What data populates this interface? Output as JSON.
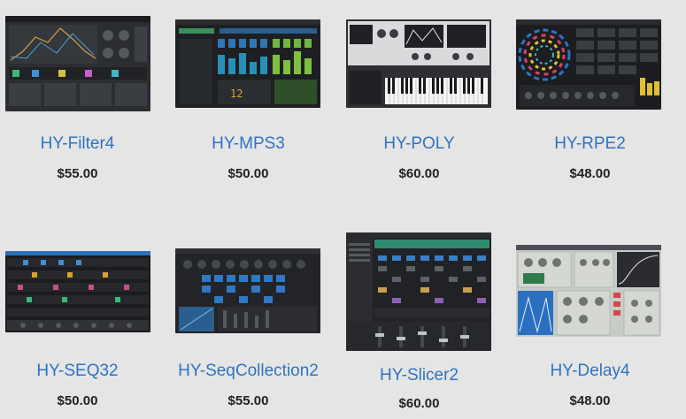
{
  "products": [
    {
      "name": "HY-Filter4",
      "price": "$55.00",
      "image": "filter-plugin-screenshot"
    },
    {
      "name": "HY-MPS3",
      "price": "$50.00",
      "image": "sequencer-plugin-screenshot"
    },
    {
      "name": "HY-POLY",
      "price": "$60.00",
      "image": "synth-with-keyboard-screenshot"
    },
    {
      "name": "HY-RPE2",
      "price": "$48.00",
      "image": "circular-sequencer-screenshot"
    },
    {
      "name": "HY-SEQ32",
      "price": "$50.00",
      "image": "step-sequencer-screenshot"
    },
    {
      "name": "HY-SeqCollection2",
      "price": "$55.00",
      "image": "sequencer-collection-screenshot"
    },
    {
      "name": "HY-Slicer2",
      "price": "$60.00",
      "image": "slicer-plugin-screenshot"
    },
    {
      "name": "HY-Delay4",
      "price": "$48.00",
      "image": "delay-plugin-screenshot"
    }
  ]
}
